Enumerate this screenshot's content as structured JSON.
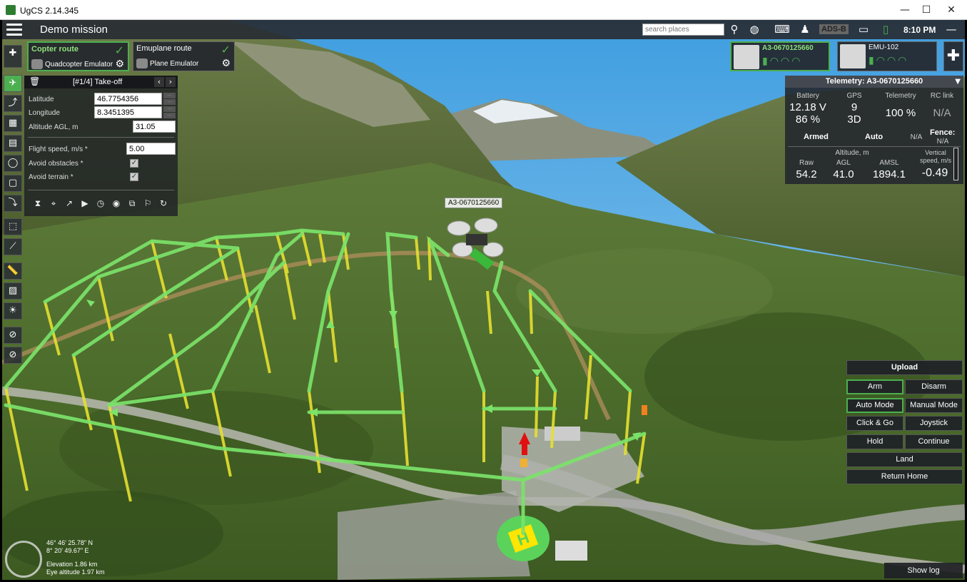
{
  "window": {
    "title": "UgCS 2.14.345",
    "controls": [
      "—",
      "☐",
      "✕"
    ]
  },
  "topbar": {
    "mission_title": "Demo mission",
    "search_placeholder": "search places",
    "adsb_label": "ADS-B",
    "clock": "8:10 PM"
  },
  "routes": [
    {
      "name": "Copter route",
      "vehicle": "Quadcopter Emulator",
      "active": true
    },
    {
      "name": "Emuplane route",
      "vehicle": "Plane Emulator",
      "active": false
    }
  ],
  "waypoint": {
    "title": "[#1/4] Take-off",
    "latitude_label": "Latitude",
    "latitude": "46.7754356",
    "longitude_label": "Longitude",
    "longitude": "8.3451395",
    "altitude_label": "Altitude AGL, m",
    "altitude": "31.05",
    "speed_label": "Flight speed, m/s *",
    "speed": "5.00",
    "avoid_obstacles_label": "Avoid obstacles *",
    "avoid_obstacles": true,
    "avoid_terrain_label": "Avoid terrain *",
    "avoid_terrain": true
  },
  "vehicles": [
    {
      "name": "A3-0670125660",
      "active": true
    },
    {
      "name": "EMU-102",
      "active": false
    }
  ],
  "telemetry": {
    "title": "Telemetry: A3-0670125660",
    "battery_label": "Battery",
    "battery_voltage": "12.18 V",
    "battery_percent": "86 %",
    "gps_label": "GPS",
    "gps_sats": "9",
    "gps_fix": "3D",
    "telemetry_label": "Telemetry",
    "telemetry_value": "100 %",
    "rclink_label": "RC link",
    "rclink_value": "N/A",
    "armed": "Armed",
    "mode": "Auto",
    "mode_extra": "N/A",
    "fence_label": "Fence:",
    "fence_value": "N/A",
    "altitude_label": "Altitude, m",
    "raw_label": "Raw",
    "raw_value": "54.2",
    "agl_label": "AGL",
    "agl_value": "41.0",
    "amsl_label": "AMSL",
    "amsl_value": "1894.1",
    "vspeed_label": "Vertical speed, m/s",
    "vspeed_value": "-0.49"
  },
  "commands": {
    "upload": "Upload",
    "arm": "Arm",
    "disarm": "Disarm",
    "auto_mode": "Auto Mode",
    "manual_mode": "Manual Mode",
    "click_go": "Click & Go",
    "joystick": "Joystick",
    "hold": "Hold",
    "continue": "Continue",
    "land": "Land",
    "return_home": "Return Home",
    "show_log": "Show log"
  },
  "map_info": {
    "lat": "46° 46' 25.78\" N",
    "lon": "8° 20' 49.67\" E",
    "elevation": "Elevation 1.86 km",
    "eye_altitude": "Eye altitude 1.97 km",
    "drone_label": "A3-0670125660"
  },
  "colors": {
    "accent": "#4caf50",
    "route_line": "#7be36a",
    "pole": "#e8e23a",
    "sky": "#5fb2e8"
  }
}
